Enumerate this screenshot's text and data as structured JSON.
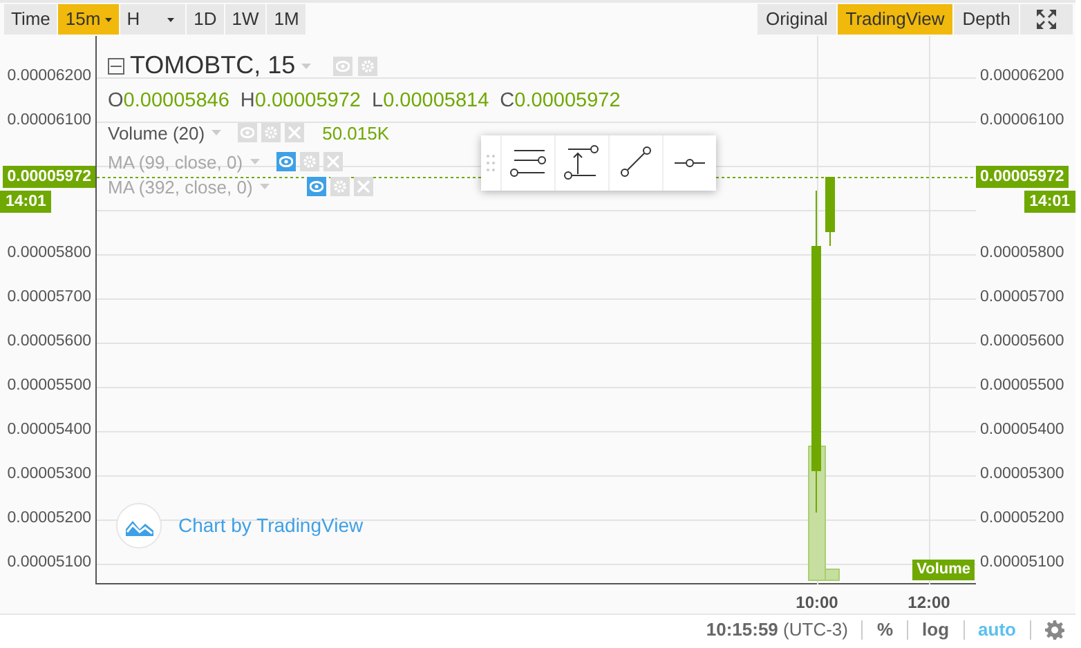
{
  "toolbar": {
    "left": [
      {
        "label": "Time",
        "selected": false,
        "dropdown": false
      },
      {
        "label": "15m",
        "selected": true,
        "dropdown": true
      },
      {
        "label": "H",
        "selected": false,
        "dropdown": true
      },
      {
        "label": "1D",
        "selected": false,
        "dropdown": false
      },
      {
        "label": "1W",
        "selected": false,
        "dropdown": false
      },
      {
        "label": "1M",
        "selected": false,
        "dropdown": false
      }
    ],
    "right": [
      {
        "label": "Original",
        "selected": false
      },
      {
        "label": "TradingView",
        "selected": true
      },
      {
        "label": "Depth",
        "selected": false
      }
    ]
  },
  "legend": {
    "symbol": "TOMOBTC, 15",
    "ohlc": [
      {
        "letter": "O",
        "value": "0.00005846"
      },
      {
        "letter": "H",
        "value": "0.00005972"
      },
      {
        "letter": "L",
        "value": "0.00005814"
      },
      {
        "letter": "C",
        "value": "0.00005972"
      }
    ],
    "indicators": [
      {
        "name": "Volume (20)",
        "visible": true,
        "value": "50.015K"
      },
      {
        "name": "MA (99, close, 0)",
        "visible": false
      },
      {
        "name": "MA (392, close, 0)",
        "visible": false
      }
    ]
  },
  "left_axis": [
    {
      "kind": "tick",
      "label": "0.00006200"
    },
    {
      "kind": "tick",
      "label": "0.00006100"
    },
    {
      "kind": "price",
      "label": "0.00005972"
    },
    {
      "kind": "time",
      "label": "14:01"
    },
    {
      "kind": "tick",
      "label": "0.00005800"
    },
    {
      "kind": "tick",
      "label": "0.00005700"
    },
    {
      "kind": "tick",
      "label": "0.00005600"
    },
    {
      "kind": "tick",
      "label": "0.00005500"
    },
    {
      "kind": "tick",
      "label": "0.00005400"
    },
    {
      "kind": "tick",
      "label": "0.00005300"
    },
    {
      "kind": "tick",
      "label": "0.00005200"
    },
    {
      "kind": "tick",
      "label": "0.00005100"
    }
  ],
  "right_axis": [
    {
      "kind": "tick",
      "label": "0.00006200"
    },
    {
      "kind": "tick",
      "label": "0.00006100"
    },
    {
      "kind": "price",
      "label": "0.00005972"
    },
    {
      "kind": "time",
      "label": "14:01"
    },
    {
      "kind": "tick",
      "label": "0.00005800"
    },
    {
      "kind": "tick",
      "label": "0.00005700"
    },
    {
      "kind": "tick",
      "label": "0.00005600"
    },
    {
      "kind": "tick",
      "label": "0.00005500"
    },
    {
      "kind": "tick",
      "label": "0.00005400"
    },
    {
      "kind": "tick",
      "label": "0.00005300"
    },
    {
      "kind": "tick",
      "label": "0.00005200"
    },
    {
      "kind": "tick",
      "label": "0.00005100"
    }
  ],
  "watermark": "Chart by TradingView",
  "volume_tag": "Volume",
  "time_axis": [
    "10:00",
    "12:00"
  ],
  "status_bar": {
    "time": "10:15:59",
    "zone": "(UTC-3)",
    "toggles": [
      {
        "label": "%",
        "on": false
      },
      {
        "label": "log",
        "on": false
      },
      {
        "label": "auto",
        "on": true
      }
    ]
  }
}
